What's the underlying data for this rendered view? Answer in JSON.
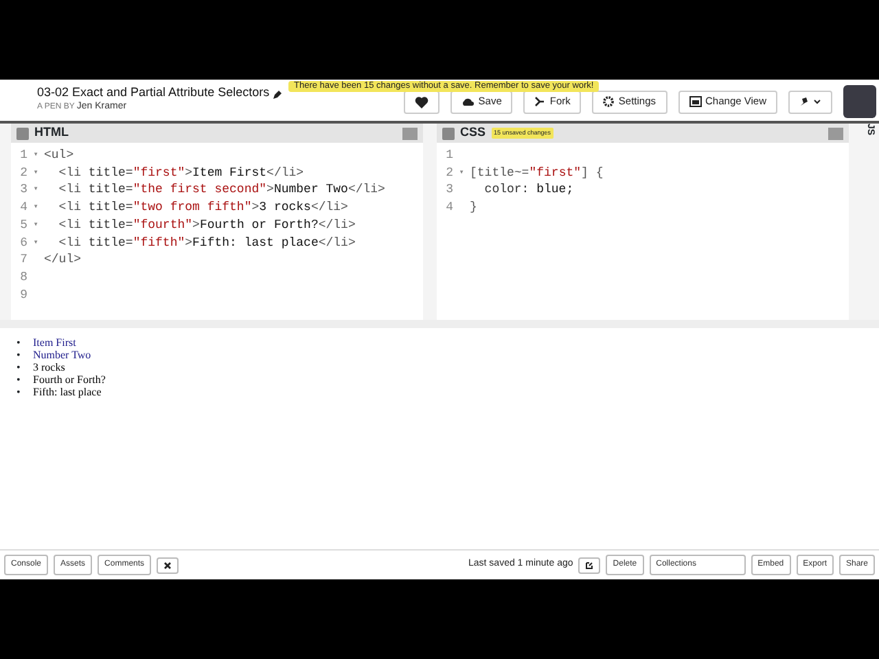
{
  "header": {
    "title": "03-02 Exact and Partial Attribute Selectors",
    "byline_prefix": "A PEN BY",
    "author": "Jen Kramer",
    "notice": "There have been 15 changes without a save. Remember to save your work!",
    "buttons": [
      {
        "kind": "heart"
      },
      {
        "kind": "save",
        "label": "Save"
      },
      {
        "kind": "fork",
        "label": "Fork"
      },
      {
        "kind": "settings",
        "label": "Settings"
      },
      {
        "kind": "view",
        "label": "Change View"
      },
      {
        "kind": "pin"
      }
    ]
  },
  "editors": [
    {
      "title": "HTML",
      "lines": [
        {
          "number": "1",
          "fold": "▾",
          "tokens": [
            {
              "kind": "tag",
              "text": "<ul>"
            }
          ]
        },
        {
          "number": "2",
          "fold": "▾",
          "tokens": [
            {
              "kind": "tag",
              "text": "  <li "
            },
            {
              "kind": "attr",
              "text": "title="
            },
            {
              "kind": "string",
              "text": "\"first\""
            },
            {
              "kind": "tag",
              "text": ">"
            },
            {
              "kind": "plain",
              "text": "Item First"
            },
            {
              "kind": "tag",
              "text": "</li>"
            }
          ]
        },
        {
          "number": "3",
          "fold": "▾",
          "tokens": [
            {
              "kind": "tag",
              "text": "  <li "
            },
            {
              "kind": "attr",
              "text": "title="
            },
            {
              "kind": "string",
              "text": "\"the first second\""
            },
            {
              "kind": "tag",
              "text": ">"
            },
            {
              "kind": "plain",
              "text": "Number Two"
            },
            {
              "kind": "tag",
              "text": "</li>"
            }
          ]
        },
        {
          "number": "4",
          "fold": "▾",
          "tokens": [
            {
              "kind": "tag",
              "text": "  <li "
            },
            {
              "kind": "attr",
              "text": "title="
            },
            {
              "kind": "string",
              "text": "\"two from fifth\""
            },
            {
              "kind": "tag",
              "text": ">"
            },
            {
              "kind": "plain",
              "text": "3 rocks"
            },
            {
              "kind": "tag",
              "text": "</li>"
            }
          ]
        },
        {
          "number": "5",
          "fold": "▾",
          "tokens": [
            {
              "kind": "tag",
              "text": "  <li "
            },
            {
              "kind": "attr",
              "text": "title="
            },
            {
              "kind": "string",
              "text": "\"fourth\""
            },
            {
              "kind": "tag",
              "text": ">"
            },
            {
              "kind": "plain",
              "text": "Fourth or Forth?"
            },
            {
              "kind": "tag",
              "text": "</li>"
            }
          ]
        },
        {
          "number": "6",
          "fold": "▾",
          "tokens": [
            {
              "kind": "tag",
              "text": "  <li "
            },
            {
              "kind": "attr",
              "text": "title="
            },
            {
              "kind": "string",
              "text": "\"fifth\""
            },
            {
              "kind": "tag",
              "text": ">"
            },
            {
              "kind": "plain",
              "text": "Fifth: last place"
            },
            {
              "kind": "tag",
              "text": "</li>"
            }
          ]
        },
        {
          "number": "7",
          "tokens": [
            {
              "kind": "tag",
              "text": "</ul>"
            }
          ]
        },
        {
          "number": "8"
        },
        {
          "number": "9"
        }
      ]
    },
    {
      "title": "CSS",
      "badge": "15 unsaved changes",
      "lines": [
        {
          "number": "1"
        },
        {
          "number": "2",
          "fold": "▾",
          "tokens": [
            {
              "kind": "tag",
              "text": "[title~="
            },
            {
              "kind": "string",
              "text": "\"first\""
            },
            {
              "kind": "tag",
              "text": "] {"
            }
          ]
        },
        {
          "number": "3",
          "tokens": [
            {
              "kind": "attr",
              "text": "  color: "
            },
            {
              "kind": "plain",
              "text": "blue;"
            }
          ]
        },
        {
          "number": "4",
          "tokens": [
            {
              "kind": "tag",
              "text": "}"
            }
          ]
        }
      ]
    }
  ],
  "side_tab": "JS",
  "preview": [
    {
      "marker": "•",
      "text": "Item First",
      "color": "#1c1a8a"
    },
    {
      "marker": "•",
      "text": "Number Two",
      "color": "#1c1a8a"
    },
    {
      "marker": "•",
      "text": "3 rocks",
      "color": "#000000"
    },
    {
      "marker": "•",
      "text": "Fourth or Forth?",
      "color": "#000000"
    },
    {
      "marker": "•",
      "text": "Fifth: last place",
      "color": "#000000"
    }
  ],
  "footer": {
    "left": [
      "Console",
      "Assets",
      "Comments"
    ],
    "status": "Last saved 1 minute ago",
    "right": [
      "Delete",
      "Collections",
      "Embed",
      "Export",
      "Share"
    ]
  }
}
